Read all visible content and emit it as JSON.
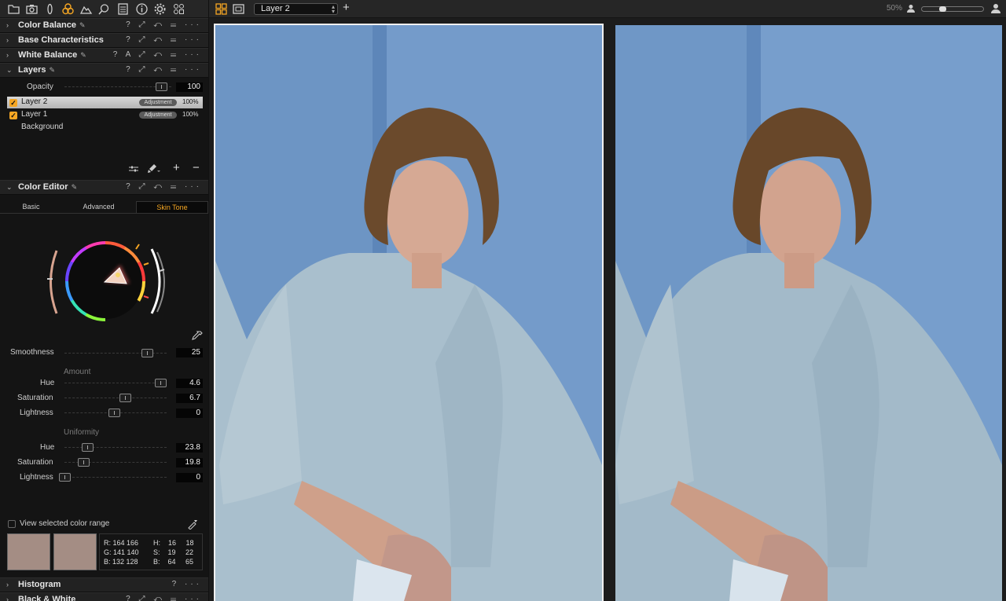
{
  "toolbar": {
    "tools": [
      "folder-icon",
      "camera-icon",
      "lens-icon",
      "color-icon",
      "exposure-icon",
      "loupe-icon",
      "details-icon",
      "metadata-icon",
      "settings-icon",
      "batch-icon"
    ],
    "layer_select": "Layer 2",
    "add_layer": "+",
    "zoom": "50%"
  },
  "panel": {
    "sections": {
      "color_balance": "Color Balance",
      "base_characteristics": "Base Characteristics",
      "white_balance": "White Balance",
      "layers": "Layers",
      "color_editor": "Color Editor",
      "histogram": "Histogram",
      "black_white": "Black & White"
    },
    "header_controls": "? ⤢ ↶ ☰ ···",
    "white_balance_controls": "? A ⤢ ↶ ☰ ···",
    "histogram_controls": "? ···",
    "layers": {
      "opacity_label": "Opacity",
      "opacity_value": "100",
      "opacity_level": 0.96,
      "items": [
        {
          "name": "Layer 2",
          "badge": "Adjustment",
          "opacity": "100%",
          "selected": true
        },
        {
          "name": "Layer 1",
          "badge": "Adjustment",
          "opacity": "100%",
          "selected": false
        },
        {
          "name": "Background"
        }
      ],
      "footer_icons": [
        "adjust-icon",
        "brush-icon",
        "add-icon",
        "remove-icon"
      ],
      "add": "+",
      "remove": "−"
    },
    "color_editor": {
      "tabs": [
        "Basic",
        "Advanced",
        "Skin Tone"
      ],
      "active_tab": "Skin Tone",
      "smoothness_label": "Smoothness",
      "smoothness_value": "25",
      "amount_heading": "Amount",
      "uniformity_heading": "Uniformity",
      "amount": {
        "hue": {
          "label": "Hue",
          "value": "4.6"
        },
        "saturation": {
          "label": "Saturation",
          "value": "6.7"
        },
        "lightness": {
          "label": "Lightness",
          "value": "0"
        }
      },
      "uniformity": {
        "hue": {
          "label": "Hue",
          "value": "23.8"
        },
        "saturation": {
          "label": "Saturation",
          "value": "19.8"
        },
        "lightness": {
          "label": "Lightness",
          "value": "0"
        }
      },
      "view_range_label": "View selected color range",
      "swatch_color": "#a48d84",
      "readout": {
        "r": "R: 164  166",
        "g": "G: 141  140",
        "b": "B: 132  128",
        "h": "H:    16     18",
        "s": "S:    19     22",
        "bb": "B:    64     65"
      }
    }
  },
  "colors": {
    "accent": "#f5a623",
    "backdrop": "#6f97c6",
    "dress": "#a9bfcd",
    "skin": "#d6a994",
    "hair": "#6b4a2c"
  }
}
